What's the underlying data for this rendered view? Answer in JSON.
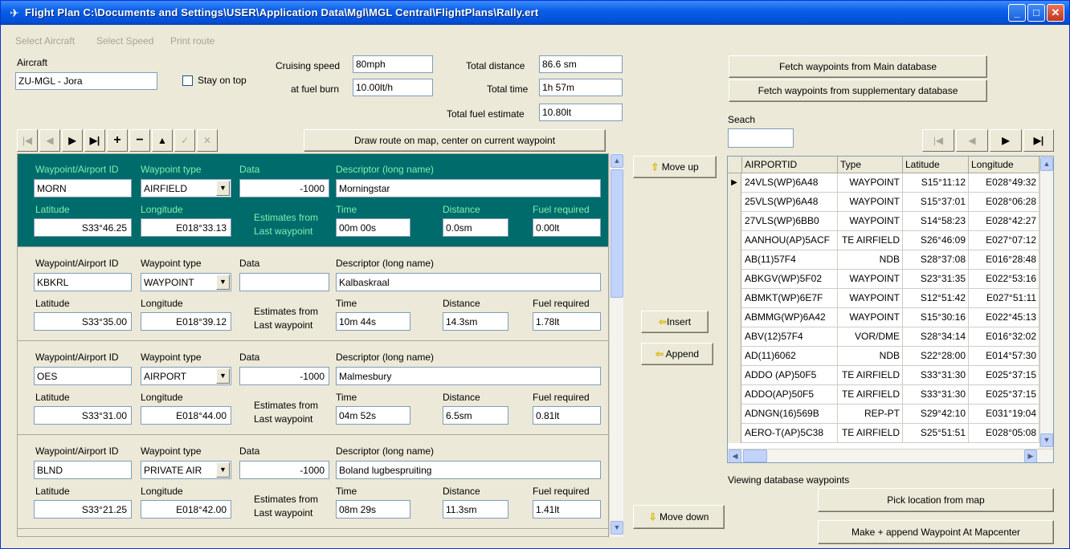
{
  "window": {
    "title": "Flight Plan C:\\Documents and Settings\\USER\\Application Data\\Mgl\\MGL Central\\FlightPlans\\Rally.ert"
  },
  "menu": [
    "Select Aircraft",
    "Select Speed",
    "Print route"
  ],
  "aircraft": {
    "label": "Aircraft",
    "value": "ZU-MGL - Jora",
    "stay_on_top_label": "Stay on top"
  },
  "stats": {
    "cruising_speed_label": "Cruising speed",
    "cruising_speed": "80mph",
    "fuel_burn_label": "at fuel burn",
    "fuel_burn": "10.00lt/h",
    "total_distance_label": "Total distance",
    "total_distance": "86.6 sm",
    "total_time_label": "Total time",
    "total_time": "1h 57m",
    "total_fuel_label": "Total fuel estimate",
    "total_fuel": "10.80lt"
  },
  "toolbar": {
    "draw_route_label": "Draw route on map, center on current waypoint"
  },
  "waypoint_labels": {
    "id": "Waypoint/Airport ID",
    "type": "Waypoint type",
    "data": "Data",
    "descriptor": "Descriptor (long name)",
    "latitude": "Latitude",
    "longitude": "Longitude",
    "estimates_1": "Estimates from",
    "estimates_2": "Last waypoint",
    "time": "Time",
    "distance": "Distance",
    "fuel": "Fuel required"
  },
  "waypoints": [
    {
      "id": "MORN",
      "type": "AIRFIELD",
      "data": "-1000",
      "descriptor": "Morningstar",
      "latitude": "S33°46.25",
      "longitude": "E018°33.13",
      "time": "00m 00s",
      "distance": "0.0sm",
      "fuel": "0.00lt"
    },
    {
      "id": "KBKRL",
      "type": "WAYPOINT",
      "data": "",
      "descriptor": "Kalbaskraal",
      "latitude": "S33°35.00",
      "longitude": "E018°39.12",
      "time": "10m 44s",
      "distance": "14.3sm",
      "fuel": "1.78lt"
    },
    {
      "id": "OES",
      "type": "AIRPORT",
      "data": "-1000",
      "descriptor": "Malmesbury",
      "latitude": "S33°31.00",
      "longitude": "E018°44.00",
      "time": "04m 52s",
      "distance": "6.5sm",
      "fuel": "0.81lt"
    },
    {
      "id": "BLND",
      "type": "PRIVATE AIR",
      "data": "-1000",
      "descriptor": "Boland lugbespruiting",
      "latitude": "S33°21.25",
      "longitude": "E018°42.00",
      "time": "08m 29s",
      "distance": "11.3sm",
      "fuel": "1.41lt"
    }
  ],
  "middle_buttons": {
    "move_up": "Move up",
    "insert": "Insert",
    "append": "Append",
    "move_down": "Move down"
  },
  "right": {
    "fetch_main": "Fetch waypoints from Main database",
    "fetch_supp": "Fetch waypoints from supplementary database",
    "search_label": "Seach",
    "search_value": "",
    "viewing_label": "Viewing database waypoints",
    "pick_location": "Pick location from map",
    "make_append": "Make + append Waypoint At Mapcenter"
  },
  "db_table": {
    "columns": [
      "AIRPORTID",
      "Type",
      "Latitude",
      "Longitude"
    ],
    "rows": [
      [
        "24VLS(WP)6A48",
        "WAYPOINT",
        "S15°11:12",
        "E028°49:32"
      ],
      [
        "25VLS(WP)6A48",
        "WAYPOINT",
        "S15°37:01",
        "E028°06:28"
      ],
      [
        "27VLS(WP)6BB0",
        "WAYPOINT",
        "S14°58:23",
        "E028°42:27"
      ],
      [
        "AANHOU(AP)5ACF",
        "TE AIRFIELD",
        "S26°46:09",
        "E027°07:12"
      ],
      [
        "AB(11)57F4",
        "NDB",
        "S28°37:08",
        "E016°28:48"
      ],
      [
        "ABKGV(WP)5F02",
        "WAYPOINT",
        "S23°31:35",
        "E022°53:16"
      ],
      [
        "ABMKT(WP)6E7F",
        "WAYPOINT",
        "S12°51:42",
        "E027°51:11"
      ],
      [
        "ABMMG(WP)6A42",
        "WAYPOINT",
        "S15°30:16",
        "E022°45:13"
      ],
      [
        "ABV(12)57F4",
        "VOR/DME",
        "S28°34:14",
        "E016°32:02"
      ],
      [
        "AD(11)6062",
        "NDB",
        "S22°28:00",
        "E014°57:30"
      ],
      [
        "ADDO (AP)50F5",
        "TE AIRFIELD",
        "S33°31:30",
        "E025°37:15"
      ],
      [
        "ADDO(AP)50F5",
        "TE AIRFIELD",
        "S33°31:30",
        "E025°37:15"
      ],
      [
        "ADNGN(16)569B",
        "REP-PT",
        "S29°42:10",
        "E031°19:04"
      ],
      [
        "AERO-T(AP)5C38",
        "TE AIRFIELD",
        "S25°51:51",
        "E028°05:08"
      ]
    ]
  }
}
